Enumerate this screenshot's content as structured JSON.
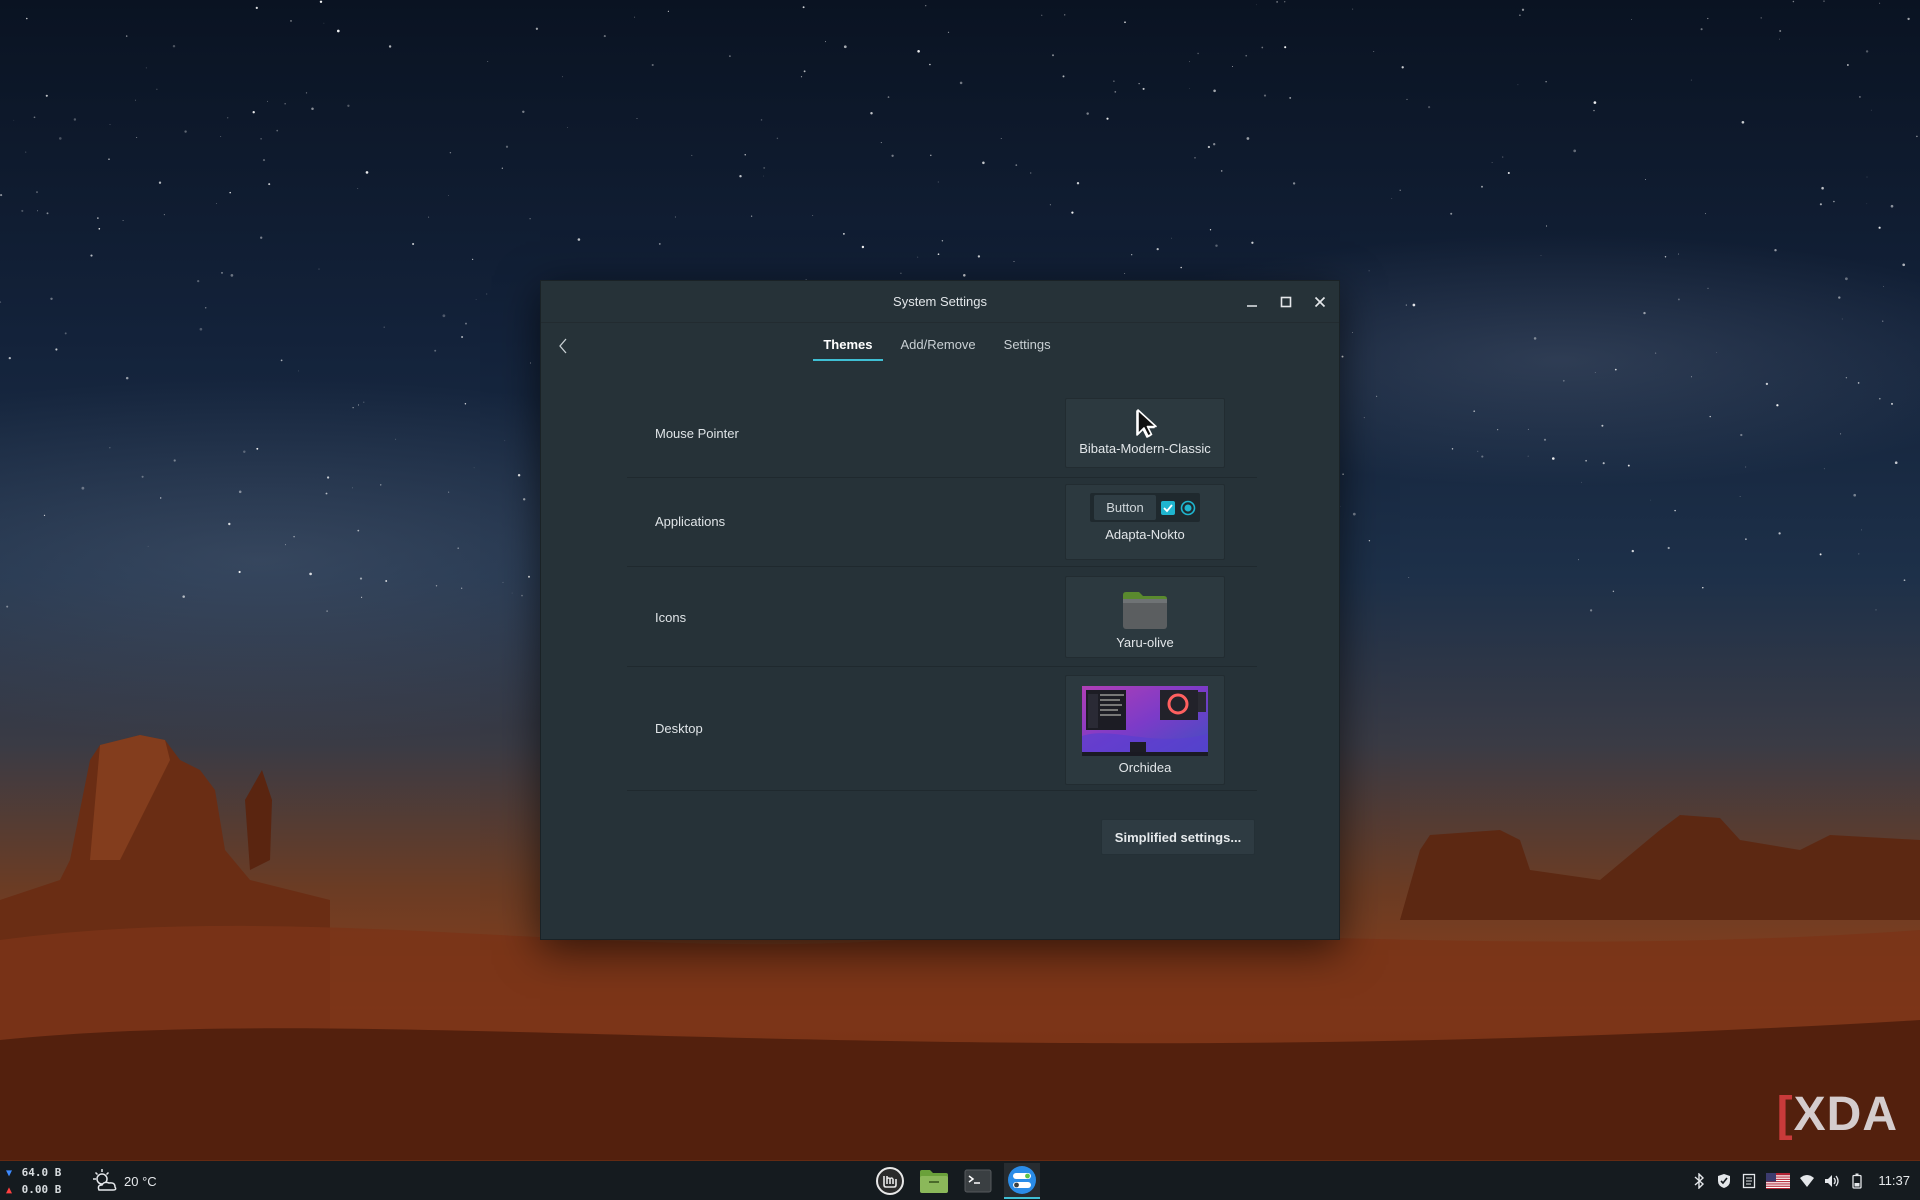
{
  "window": {
    "title": "System Settings",
    "tabs": [
      {
        "label": "Themes",
        "active": true
      },
      {
        "label": "Add/Remove",
        "active": false
      },
      {
        "label": "Settings",
        "active": false
      }
    ],
    "rows": {
      "mouse_pointer": {
        "label": "Mouse Pointer",
        "value": "Bibata-Modern-Classic"
      },
      "applications": {
        "label": "Applications",
        "value": "Adapta-Nokto",
        "preview_button_label": "Button"
      },
      "icons": {
        "label": "Icons",
        "value": "Yaru-olive"
      },
      "desktop": {
        "label": "Desktop",
        "value": "Orchidea"
      }
    },
    "simplified_settings_label": "Simplified settings..."
  },
  "taskbar": {
    "net_down": "64.0 B",
    "net_up": "0.00 B",
    "temperature": "20 °C",
    "clock": "11:37",
    "apps": [
      "mint-menu-icon",
      "files-icon",
      "terminal-icon",
      "system-settings-icon"
    ]
  },
  "watermark": {
    "text": "XDA"
  },
  "colors": {
    "accent": "#3fbfd4",
    "window_bg": "#263238",
    "taskbar_bg": "#151b1f",
    "folder_green": "#5a8a2e"
  }
}
